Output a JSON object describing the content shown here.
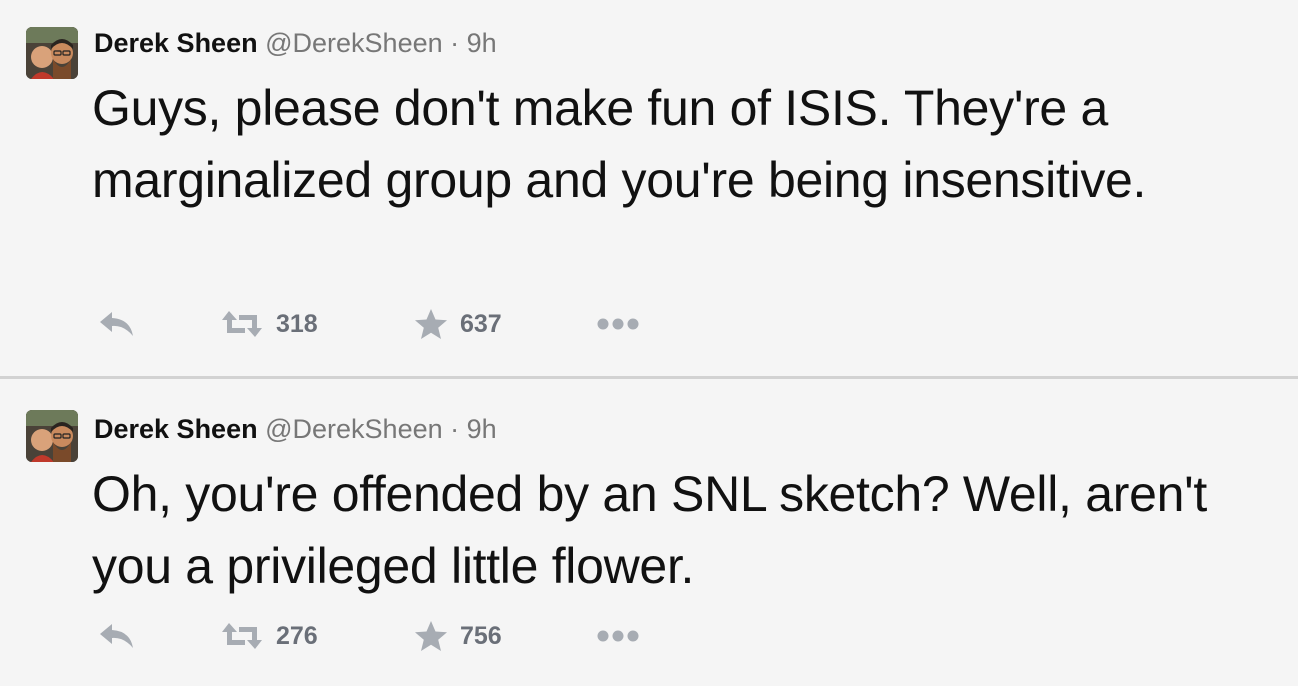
{
  "tweets": [
    {
      "author": {
        "name": "Derek Sheen",
        "handle": "@DerekSheen",
        "separator": "·",
        "time": "9h",
        "avatar_icon": "avatar-photo"
      },
      "text": "Guys, please don't make fun of ISIS. They're a marginalized group and you're being insensitive.",
      "actions": {
        "reply_icon": "reply-icon",
        "retweet_icon": "retweet-icon",
        "retweet_count": "318",
        "favorite_icon": "star-icon",
        "favorite_count": "637",
        "more_icon": "more-dots-icon"
      }
    },
    {
      "author": {
        "name": "Derek Sheen",
        "handle": "@DerekSheen",
        "separator": "·",
        "time": "9h",
        "avatar_icon": "avatar-photo"
      },
      "text": "Oh, you're offended by an SNL sketch? Well, aren't you a privileged little flower.",
      "actions": {
        "reply_icon": "reply-icon",
        "retweet_icon": "retweet-icon",
        "retweet_count": "276",
        "favorite_icon": "star-icon",
        "favorite_count": "756",
        "more_icon": "more-dots-icon"
      }
    }
  ],
  "colors": {
    "background": "#f5f5f5",
    "text": "#111111",
    "muted": "#777777",
    "icon": "#a7acb3",
    "count": "#6a6f78",
    "divider": "#d2d2d2"
  }
}
